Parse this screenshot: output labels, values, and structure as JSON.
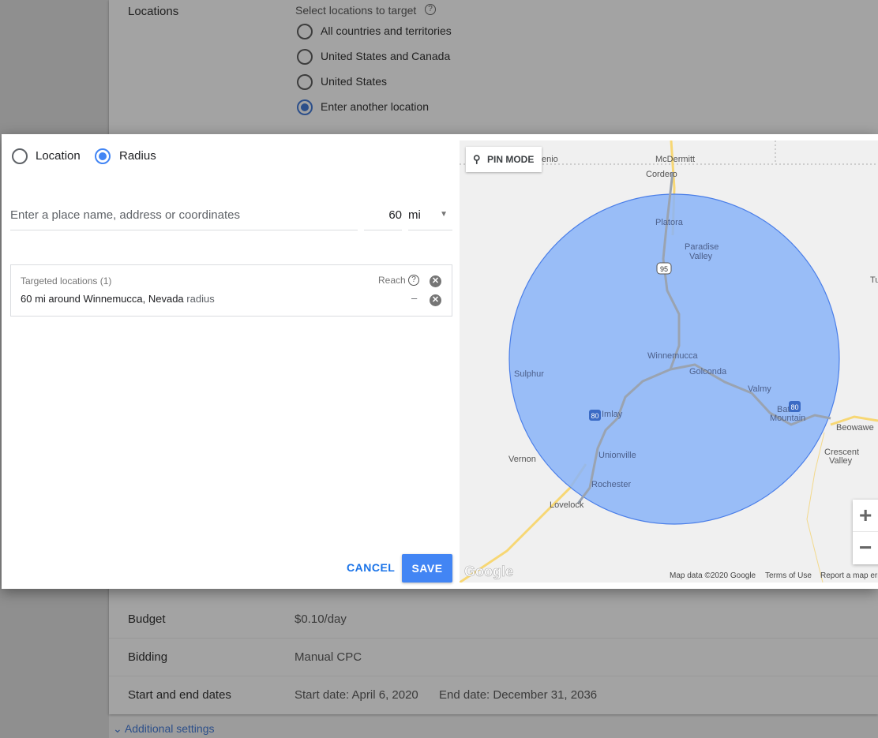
{
  "background": {
    "locations_label": "Locations",
    "select_label": "Select locations to target",
    "options": [
      "All countries and territories",
      "United States and Canada",
      "United States",
      "Enter another location"
    ],
    "selected_option": 3,
    "rows": [
      {
        "label": "Budget",
        "value": "$0.10/day"
      },
      {
        "label": "Bidding",
        "value": "Manual CPC"
      },
      {
        "label": "Start and end dates",
        "value": "Start date: April 6, 2020",
        "value2": "End date: December 31, 2036"
      }
    ],
    "additional_settings": "Additional settings"
  },
  "dialog": {
    "mode_options": [
      "Location",
      "Radius"
    ],
    "selected_mode": "Radius",
    "search_placeholder": "Enter a place name, address or coordinates",
    "radius_value": "60",
    "radius_unit": "mi",
    "targeted_header": "Targeted locations (1)",
    "reach_label": "Reach",
    "target_item": "60 mi around Winnemucca, Nevada",
    "target_item_type": "radius",
    "target_reach": "–",
    "cancel": "CANCEL",
    "save": "SAVE",
    "accent": "#4285f4"
  },
  "map": {
    "pin_mode": "PIN MODE",
    "places": [
      "McDermitt",
      "Cordero",
      "Platora",
      "Paradise",
      "Valley",
      "Winnemucca",
      "Golconda",
      "Valmy",
      "Battle",
      "Mountain",
      "Sulphur",
      "Imlay",
      "Unionville",
      "Rochester",
      "Vernon",
      "Lovelock",
      "Beowawe",
      "Crescent",
      "Valley",
      "enio",
      "Tu"
    ],
    "shields": [
      "95",
      "80",
      "80"
    ],
    "logo": "Google",
    "map_data": "Map data ©2020 Google",
    "terms": "Terms of Use",
    "report": "Report a map error",
    "zoom_in": "+",
    "zoom_out": "−",
    "radius_fill": "#8ab4f8"
  }
}
